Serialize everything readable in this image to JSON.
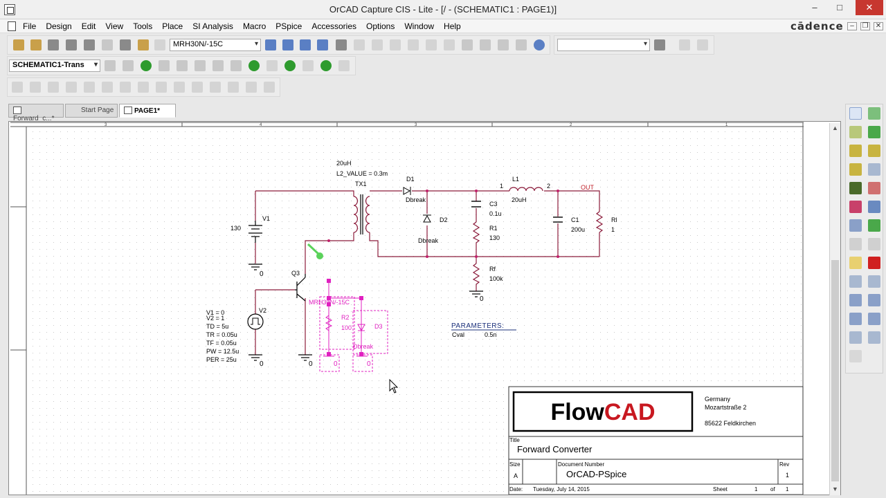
{
  "window": {
    "title": "OrCAD Capture CIS - Lite - [/ - (SCHEMATIC1 : PAGE1)]",
    "minimize": "–",
    "maximize": "□",
    "close": "✕"
  },
  "menu": {
    "items": [
      "File",
      "Design",
      "Edit",
      "View",
      "Tools",
      "Place",
      "SI Analysis",
      "Macro",
      "PSpice",
      "Accessories",
      "Options",
      "Window",
      "Help"
    ],
    "brand": "cādence",
    "mdi": [
      "–",
      "❐",
      "✕"
    ]
  },
  "toolbar": {
    "part_combo": "MRH30N/-15C",
    "search_combo": "",
    "profile_combo": "SCHEMATIC1-Trans"
  },
  "tabs": [
    {
      "label": "Forward_c...*"
    },
    {
      "label": "Start Page"
    },
    {
      "label": "PAGE1*"
    }
  ],
  "schematic": {
    "ruler_labels": [
      "3",
      "4",
      "3",
      "2",
      "1"
    ],
    "labels": {
      "l1_value": "20uH",
      "l2_value": "L2_VALUE = 0.3m",
      "tx1": "TX1",
      "d1": "D1",
      "d1_model": "Dbreak",
      "d2": "D2",
      "d2_model": "Dbreak",
      "l1": "L1",
      "l1_pin1": "1",
      "l1_pin2": "2",
      "out": "OUT",
      "c3": "C3",
      "c3_value": "0.1u",
      "r1": "R1",
      "r1_value": "130",
      "c1": "C1",
      "c1_value": "200u",
      "rl": "Rl",
      "rl_value": "1",
      "rf": "Rf",
      "rf_value": "100k",
      "rf_gnd": "0",
      "v1": "V1",
      "v1_value": "130",
      "v1_gnd": "0",
      "q3": "Q3",
      "q3_model": "MRH30N/-15C",
      "q3_gnd": "0",
      "r2": "R2",
      "r2_value": "100",
      "r2_gnd": "0",
      "d3": "D3",
      "d3_model": "Dbreak",
      "d3_gnd": "0",
      "v2": "V2",
      "v2_gnd": "0",
      "v2_params": [
        "V1 = 0",
        "V2 = 1",
        "TD = 5u",
        "TR = 0.05u",
        "TF = 0.05u",
        "PW = 12.5u",
        "PER = 25u"
      ],
      "parameters_title": "PARAMETERS:",
      "param_name": "Cval",
      "param_value": "0.5n"
    },
    "title_block": {
      "logo": "FlowCAD",
      "address": [
        "Germany",
        "Mozartstraße 2",
        "",
        "85622 Feldkirchen"
      ],
      "title_label": "Title",
      "title": "Forward Converter",
      "size_label": "Size",
      "size": "A",
      "docnum_label": "Document Number",
      "docnum": "OrCAD-PSpice",
      "rev_label": "Rev",
      "rev": "1",
      "date_label": "Date:",
      "date": "Tuesday, July 14, 2015",
      "sheet_label": "Sheet",
      "sheet": "1",
      "of_label": "of",
      "of": "1"
    }
  },
  "colors": {
    "wire": "#8b1a3a",
    "selected": "#e020c0",
    "net_label": "#c0202a",
    "param_text": "#1a2f7a",
    "ground": "#000000"
  }
}
